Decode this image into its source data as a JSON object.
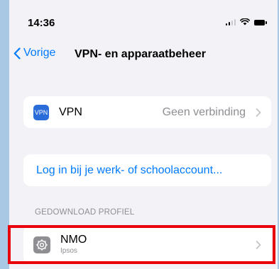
{
  "status_bar": {
    "time": "14:36"
  },
  "nav": {
    "back_label": "Vorige",
    "title": "VPN- en apparaatbeheer"
  },
  "vpn": {
    "icon_text": "VPN",
    "label": "VPN",
    "status": "Geen verbinding"
  },
  "login": {
    "link": "Log in bij je werk- of schoolaccount..."
  },
  "downloaded_section": {
    "header": "GEDOWNLOAD PROFIEL"
  },
  "profile": {
    "name": "NMO",
    "subtitle": "Ipsos"
  },
  "colors": {
    "accent": "#007aff",
    "highlight": "#e8000b",
    "vpn_icon": "#2a6dd9",
    "background": "#f2f2f7",
    "outer_background": "#a8c8e3"
  }
}
